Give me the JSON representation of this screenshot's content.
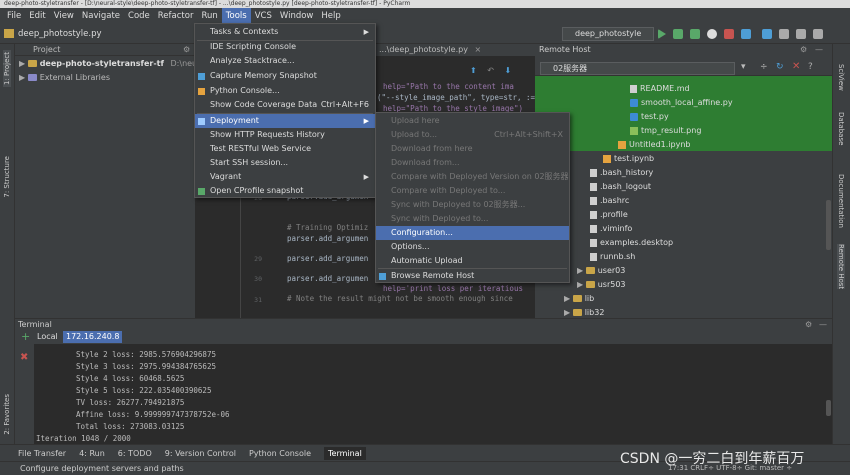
{
  "window": {
    "title": "deep-photo-styletransfer - [D:\\neural-style\\deep-photo-styletransfer-tf] - ...\\deep_photostyle.py [deep-photo-styletransfer-tf] - PyCharm"
  },
  "menubar": [
    "File",
    "Edit",
    "View",
    "Navigate",
    "Code",
    "Refactor",
    "Run",
    "Tools",
    "VCS",
    "Window",
    "Help"
  ],
  "toolbar": {
    "breadcrumb": "deep_photostyle.py",
    "run_config": "deep_photostyle"
  },
  "left_strip": {
    "project": "1: Project",
    "structure": "7: Structure",
    "favorites": "2: Favorites"
  },
  "right_strip": {
    "sciview": "SciView",
    "database": "Database",
    "documentation": "Documentation",
    "remote_host": "Remote Host"
  },
  "project": {
    "header": "Project",
    "root": "deep-photo-styletransfer-tf",
    "root_path": "D:\\neural",
    "external": "External Libraries"
  },
  "editor": {
    "tab": "...\\deep_photostyle.py",
    "lines": [
      {
        "n": "",
        "text": "help=\"Path to the content ima"
      },
      {
        "n": "",
        "text": "(\"--style_image_path\", type=str, :='s"
      },
      {
        "n": "",
        "text": "help=\"Path to the style image\")"
      },
      {
        "n": "",
        "text": "parser.add_argumen"
      },
      {
        "n": "",
        "text": "# Training Optimiz"
      },
      {
        "n": "",
        "text": "parser.add_argumen"
      },
      {
        "n": "",
        "text": "parser.add_argumen"
      },
      {
        "n": "",
        "text": "parser.add_argumen"
      },
      {
        "n": "",
        "text": "help='print loss per iteratious"
      },
      {
        "n": "",
        "text": "# Note the result might not be smooth enough since"
      }
    ],
    "gutter": [
      "28",
      "29",
      "30",
      "31"
    ]
  },
  "remote": {
    "header": "Remote Host",
    "server": "02服务器",
    "files": [
      {
        "name": "README.md",
        "type": "text",
        "hl": true
      },
      {
        "name": "smooth_local_affine.py",
        "type": "py",
        "hl": true
      },
      {
        "name": "test.py",
        "type": "py",
        "hl": true
      },
      {
        "name": "tmp_result.png",
        "type": "img",
        "hl": true
      },
      {
        "name": "Untitled1.ipynb",
        "type": "nb",
        "hl": true
      },
      {
        "name": "test.ipynb",
        "type": "nb",
        "hl": false
      },
      {
        "name": ".bash_history",
        "type": "text",
        "hl": false
      },
      {
        "name": ".bash_logout",
        "type": "text",
        "hl": false
      },
      {
        "name": ".bashrc",
        "type": "text",
        "hl": false
      },
      {
        "name": ".profile",
        "type": "text",
        "hl": false
      },
      {
        "name": ".viminfo",
        "type": "text",
        "hl": false
      },
      {
        "name": "examples.desktop",
        "type": "text",
        "hl": false
      },
      {
        "name": "runnb.sh",
        "type": "text",
        "hl": false
      },
      {
        "name": "user03",
        "type": "folder",
        "hl": false
      },
      {
        "name": "usr503",
        "type": "folder",
        "hl": false
      },
      {
        "name": "lib",
        "type": "folder",
        "hl": false
      },
      {
        "name": "lib32",
        "type": "folder",
        "hl": false
      }
    ]
  },
  "tools_menu": [
    {
      "label": "Tasks & Contexts",
      "arrow": true
    },
    {
      "label": "IDE Scripting Console"
    },
    {
      "label": "Analyze Stacktrace..."
    },
    {
      "label": "Capture Memory Snapshot"
    },
    {
      "label": "Python Console..."
    },
    {
      "label": "Show Code Coverage Data",
      "shortcut": "Ctrl+Alt+F6"
    },
    {
      "label": "Deployment",
      "arrow": true,
      "hl": true
    },
    {
      "label": "Show HTTP Requests History"
    },
    {
      "label": "Test RESTful Web Service"
    },
    {
      "label": "Start SSH session..."
    },
    {
      "label": "Vagrant",
      "arrow": true
    },
    {
      "label": "Open CProfile snapshot"
    }
  ],
  "deployment_menu": [
    {
      "label": "Upload here",
      "dis": true
    },
    {
      "label": "Upload to...",
      "shortcut": "Ctrl+Alt+Shift+X",
      "dis": true
    },
    {
      "label": "Download from here",
      "dis": true
    },
    {
      "label": "Download from...",
      "dis": true
    },
    {
      "label": "Compare with Deployed Version on 02服务器",
      "dis": true
    },
    {
      "label": "Compare with Deployed to...",
      "dis": true
    },
    {
      "label": "Sync with Deployed to 02服务器...",
      "dis": true
    },
    {
      "label": "Sync with Deployed to...",
      "dis": true
    },
    {
      "label": "Configuration...",
      "hl": true
    },
    {
      "label": "Options..."
    },
    {
      "label": "Automatic Upload"
    },
    {
      "label": "Browse Remote Host"
    }
  ],
  "terminal": {
    "header": "Terminal",
    "tabs": [
      "Local",
      "172.16.240.8"
    ],
    "lines": [
      "Style 2 loss: 2985.576904296875",
      "Style 3 loss: 2975.994384765625",
      "Style 4 loss: 60468.5625",
      "Style 5 loss: 222.035400390625",
      "TV loss: 26277.794921875",
      "Affine loss: 9.999999747378752e-06",
      "Total loss: 273083.03125",
      "Iteration 1048 / 2000"
    ]
  },
  "bottom_tabs": [
    "File Transfer",
    "4: Run",
    "6: TODO",
    "9: Version Control",
    "Python Console",
    "Terminal"
  ],
  "status": {
    "text": "Configure deployment servers and paths",
    "right": "17:31  CRLF÷  UTF-8÷  Git: master ÷"
  },
  "watermark": "CSDN @一穷二白到年薪百万"
}
